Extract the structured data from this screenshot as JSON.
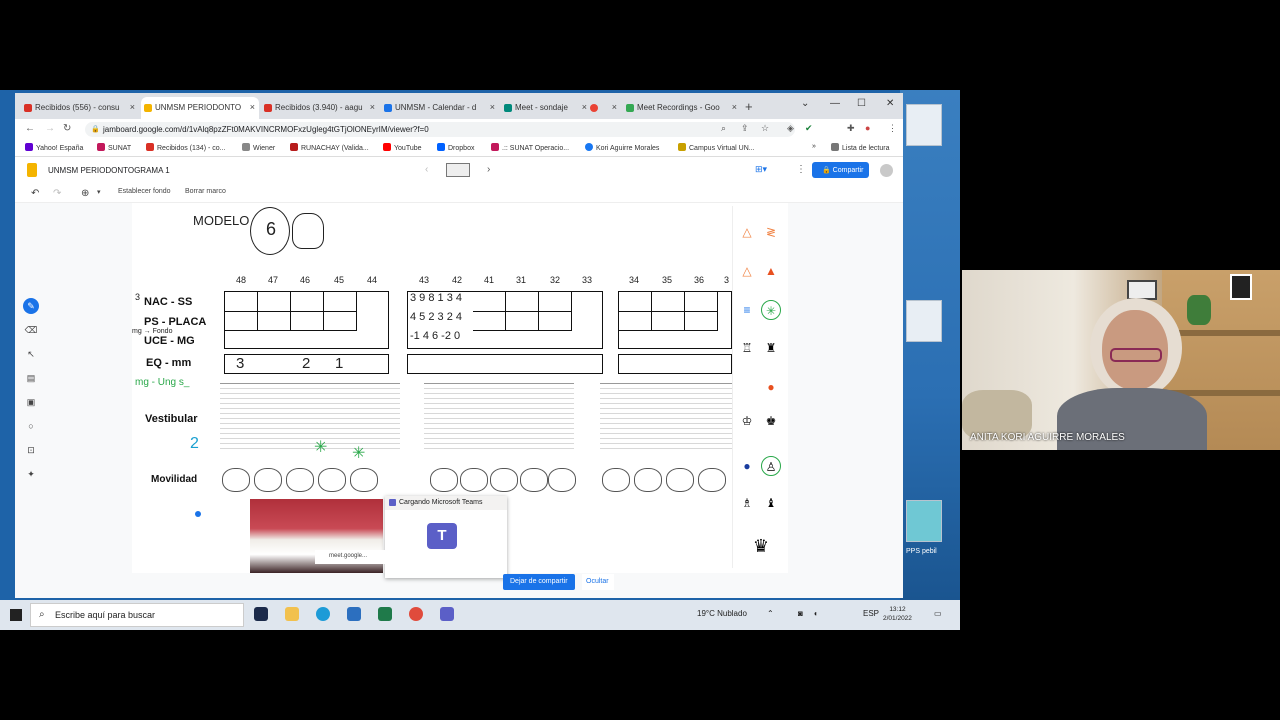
{
  "browser": {
    "tabs": [
      {
        "label": "Recibidos (556) - consu",
        "color": "#d93025"
      },
      {
        "label": "UNMSM PERIODONTO",
        "color": "#f4b400",
        "active": true
      },
      {
        "label": "Recibidos (3.940) - aagu",
        "color": "#d93025"
      },
      {
        "label": "UNMSM - Calendar - d",
        "color": "#1a73e8"
      },
      {
        "label": "Meet - sondaje",
        "color": "#00897b"
      },
      {
        "label": "",
        "color": "#ea4335"
      },
      {
        "label": "Meet Recordings - Goo",
        "color": "#34a853"
      }
    ],
    "url": "jamboard.google.com/d/1vAlq8pzZFt0MAKVINCRMOFxzUgleg4tGTjOlONEyrIM/viewer?f=0",
    "bookmarks": [
      {
        "label": "Yahoo! España",
        "color": "#6001d2"
      },
      {
        "label": "SUNAT",
        "color": "#c2185b"
      },
      {
        "label": "Recibidos (134) - co...",
        "color": "#d93025"
      },
      {
        "label": "Wiener",
        "color": "#888888"
      },
      {
        "label": "RUNACHAY (Valida...",
        "color": "#b71c1c"
      },
      {
        "label": "YouTube",
        "color": "#ff0000"
      },
      {
        "label": "Dropbox",
        "color": "#0061ff"
      },
      {
        "label": ".:: SUNAT Operacio...",
        "color": "#c2185b"
      },
      {
        "label": "Kori Aguirre Morales",
        "color": "#1877f2"
      },
      {
        "label": "Campus Virtual UN...",
        "color": "#c8a000"
      }
    ],
    "reading_list": "Lista de lectura"
  },
  "jamboard": {
    "title": "UNMSM PERIODONTOGRAMA 1",
    "share_label": "Compartir",
    "set_background": "Establecer fondo",
    "clear_frame": "Borrar marco"
  },
  "board": {
    "modelo": "MODELO",
    "modelo_circle": "6",
    "tooth_numbers_right": [
      "48",
      "47",
      "46",
      "45",
      "44"
    ],
    "tooth_numbers_center": [
      "43",
      "42",
      "41",
      "31",
      "32",
      "33"
    ],
    "tooth_numbers_left": [
      "34",
      "35",
      "36",
      "3"
    ],
    "rows": {
      "nac": "NAC - SS",
      "ps": "PS - PLACA",
      "uce": "UCE - MG",
      "eq": "EQ - mm"
    },
    "handwritten": {
      "nac_prefix": "3",
      "mg_fondo": "mg → Fondo",
      "mg_ung": "mg - Ung s_",
      "eq_values": [
        "3",
        "2",
        "1"
      ],
      "row1": "3 9 8 1 3 4",
      "row2": "4 5 2 3 2 4",
      "row3": "-1 4 6 -2 0",
      "two_arrow": "2"
    },
    "vestibular": "Vestibular",
    "movilidad": "Movilidad"
  },
  "overlays": {
    "teams_loading": "Cargando Microsoft Teams",
    "meet_tab": "meet.google...",
    "stop_sharing": "Dejar de compartir",
    "hide": "Ocultar"
  },
  "taskbar": {
    "search_placeholder": "Escribe aquí para buscar",
    "weather": "19°C Nublado",
    "lang": "ESP",
    "time": "13:12",
    "date": "2/01/2022"
  },
  "desktop": {
    "icons": [
      "...",
      "...",
      "PPS pebil"
    ]
  },
  "video": {
    "participant_name": "ANITA KORI AGUIRRE MORALES"
  }
}
